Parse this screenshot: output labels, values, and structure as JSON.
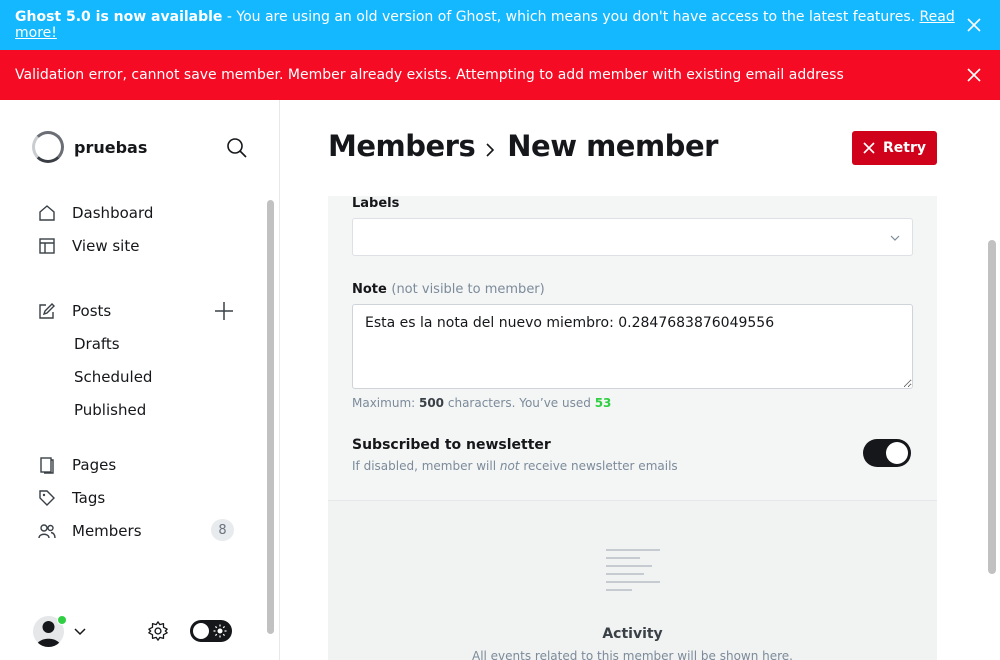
{
  "banners": {
    "update": {
      "strong": "Ghost 5.0 is now available",
      "text": " - You are using an old version of Ghost, which means you don't have access to the latest features. ",
      "link": "Read more!"
    },
    "error": {
      "text": "Validation error, cannot save member. Member already exists. Attempting to add member with existing email address"
    }
  },
  "sidebar": {
    "site_name": "pruebas",
    "nav": [
      {
        "label": "Dashboard",
        "icon": "home-icon"
      },
      {
        "label": "View site",
        "icon": "layout-icon"
      },
      {
        "label": "Posts",
        "icon": "edit-icon"
      },
      {
        "label": "Pages",
        "icon": "pages-icon"
      },
      {
        "label": "Tags",
        "icon": "tag-icon"
      },
      {
        "label": "Members",
        "icon": "members-icon",
        "count": "8"
      }
    ],
    "posts_sub": [
      "Drafts",
      "Scheduled",
      "Published"
    ]
  },
  "header": {
    "breadcrumb_parent": "Members",
    "breadcrumb_current": "New member",
    "retry_label": "Retry"
  },
  "form": {
    "labels_label": "Labels",
    "note_label": "Note",
    "note_hint": "(not visible to member)",
    "note_value": "Esta es la nota del nuevo miembro: 0.2847683876049556",
    "max_prefix": "Maximum: ",
    "max_chars": "500",
    "max_mid": " characters. You’ve used ",
    "used_chars": "53",
    "newsletter_title": "Subscribed to newsletter",
    "newsletter_desc_pre": "If disabled, member will ",
    "newsletter_desc_em": "not",
    "newsletter_desc_post": " receive newsletter emails",
    "newsletter_enabled": true
  },
  "activity": {
    "title": "Activity",
    "description": "All events related to this member will be shown here."
  },
  "colors": {
    "update_banner": "#14b8ff",
    "error_banner": "#f50b23",
    "retry": "#d0021b",
    "accent_green": "#30cf43"
  }
}
